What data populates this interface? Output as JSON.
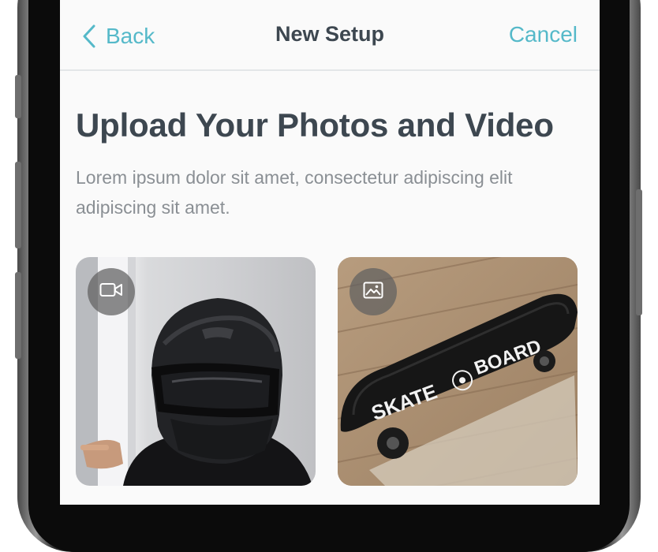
{
  "nav": {
    "back_label": "Back",
    "title": "New Setup",
    "cancel_label": "Cancel",
    "back_icon": "chevron-left-icon"
  },
  "content": {
    "headline": "Upload Your Photos and Video",
    "description": "Lorem ipsum dolor sit amet, consectetur adipiscing elit adipiscing sit amet."
  },
  "media": [
    {
      "kind": "video",
      "icon": "video-camera-icon",
      "subject": "person in black motorcycle helmet"
    },
    {
      "kind": "photo",
      "icon": "image-icon",
      "subject": "skateboard on wooden floor",
      "deck_text": "SKATE BOARD"
    }
  ],
  "colors": {
    "accent": "#55b9c9",
    "title_text": "#3d4750",
    "body_text": "#8a8f94",
    "divider": "#e3e6e8",
    "background": "#fafafa"
  }
}
